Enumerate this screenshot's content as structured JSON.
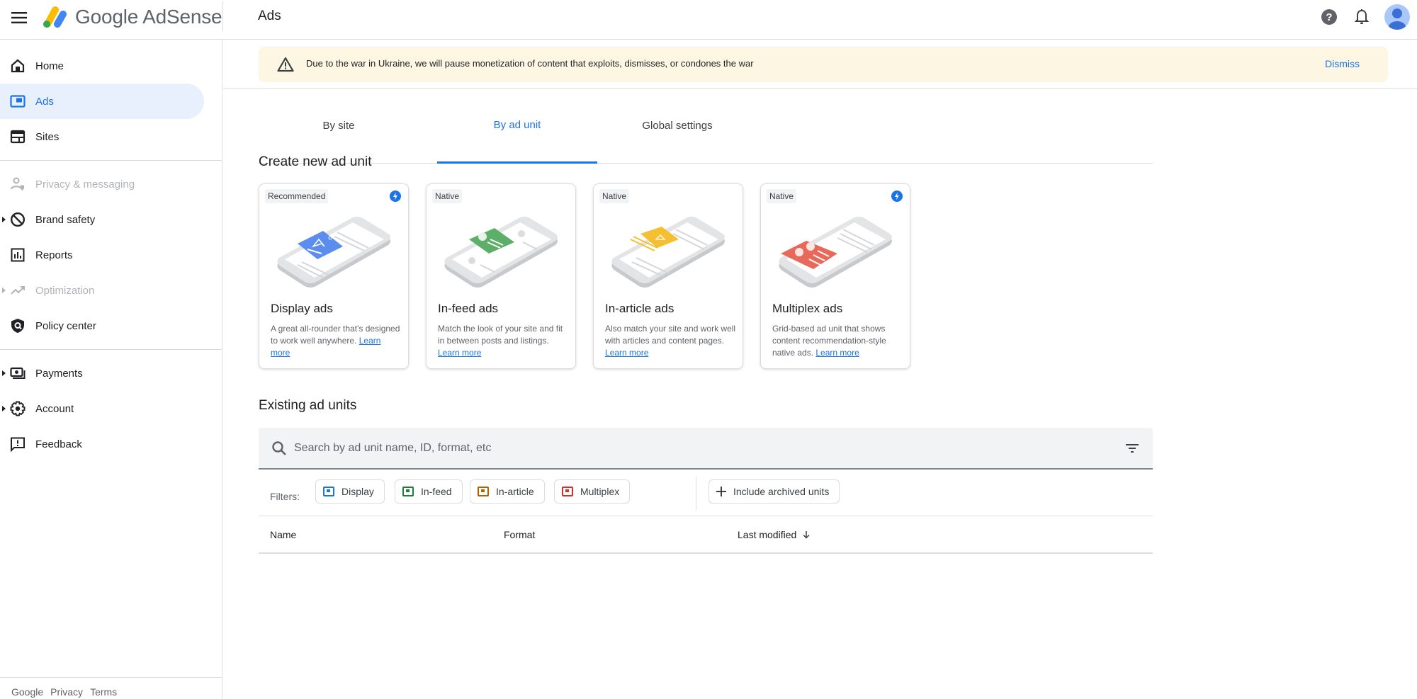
{
  "app": {
    "name": "Google AdSense",
    "page_title": "Ads"
  },
  "topbar": {
    "menu_icon": "hamburger-menu-icon",
    "help_icon": "help-icon",
    "notifications_icon": "bell-icon",
    "avatar_icon": "account-avatar-icon"
  },
  "sidebar": {
    "items": [
      {
        "label": "Home",
        "icon": "home-icon",
        "state": "normal",
        "expandable": false
      },
      {
        "label": "Ads",
        "icon": "ads-icon",
        "state": "active",
        "expandable": false
      },
      {
        "label": "Sites",
        "icon": "sites-icon",
        "state": "normal",
        "expandable": false
      },
      {
        "label": "Privacy & messaging",
        "icon": "privacy-icon",
        "state": "disabled",
        "expandable": false
      },
      {
        "label": "Brand safety",
        "icon": "block-icon",
        "state": "normal",
        "expandable": true
      },
      {
        "label": "Reports",
        "icon": "reports-icon",
        "state": "normal",
        "expandable": false
      },
      {
        "label": "Optimization",
        "icon": "trending-up-icon",
        "state": "disabled",
        "expandable": true
      },
      {
        "label": "Policy center",
        "icon": "policy-shield-icon",
        "state": "normal",
        "expandable": false
      },
      {
        "label": "Payments",
        "icon": "payments-icon",
        "state": "normal",
        "expandable": true
      },
      {
        "label": "Account",
        "icon": "gear-icon",
        "state": "normal",
        "expandable": true
      },
      {
        "label": "Feedback",
        "icon": "feedback-icon",
        "state": "normal",
        "expandable": false
      }
    ],
    "footer": {
      "google": "Google",
      "privacy": "Privacy",
      "terms": "Terms"
    }
  },
  "banner": {
    "icon": "warning-icon",
    "text": "Due to the war in Ukraine, we will pause monetization of content that exploits, dismisses, or condones the war",
    "dismiss_label": "Dismiss",
    "background": "#fdf6e3"
  },
  "tabs": [
    {
      "label": "By site",
      "active": false
    },
    {
      "label": "By ad unit",
      "active": true
    },
    {
      "label": "Global settings",
      "active": false
    }
  ],
  "create_section": {
    "title": "Create new ad unit",
    "cards": [
      {
        "badge": "Recommended",
        "bolt": true,
        "title": "Display ads",
        "desc": "A great all-rounder that's designed to work well anywhere. ",
        "link": "Learn more",
        "color": "#5b8def"
      },
      {
        "badge": "Native",
        "bolt": false,
        "title": "In-feed ads",
        "desc": "Match the look of your site and fit in between posts and listings. ",
        "link": "Learn more",
        "color": "#5cae68"
      },
      {
        "badge": "Native",
        "bolt": false,
        "title": "In-article ads",
        "desc": "Also match your site and work well with articles and content pages. ",
        "link": "Learn more",
        "color": "#f4bf30"
      },
      {
        "badge": "Native",
        "bolt": true,
        "title": "Multiplex ads",
        "desc": "Grid-based ad unit that shows content recommendation-style native ads. ",
        "link": "Learn more",
        "color": "#e8685a"
      }
    ]
  },
  "existing_section": {
    "title": "Existing ad units",
    "search_placeholder": "Search by ad unit name, ID, format, etc",
    "search_value": "",
    "filters_label": "Filters:",
    "filters": [
      {
        "label": "Display",
        "color": "#1a73e8"
      },
      {
        "label": "In-feed",
        "color": "#188038"
      },
      {
        "label": "In-article",
        "color": "#b06000"
      },
      {
        "label": "Multiplex",
        "color": "#d93025"
      }
    ],
    "include_archived": "Include archived units",
    "columns": [
      {
        "label": "Name"
      },
      {
        "label": "Format"
      },
      {
        "label": "Last modified",
        "sort": "descending"
      }
    ],
    "rows": []
  },
  "colors": {
    "accent": "#1a73e8",
    "active_bg": "#e8f0fe"
  }
}
